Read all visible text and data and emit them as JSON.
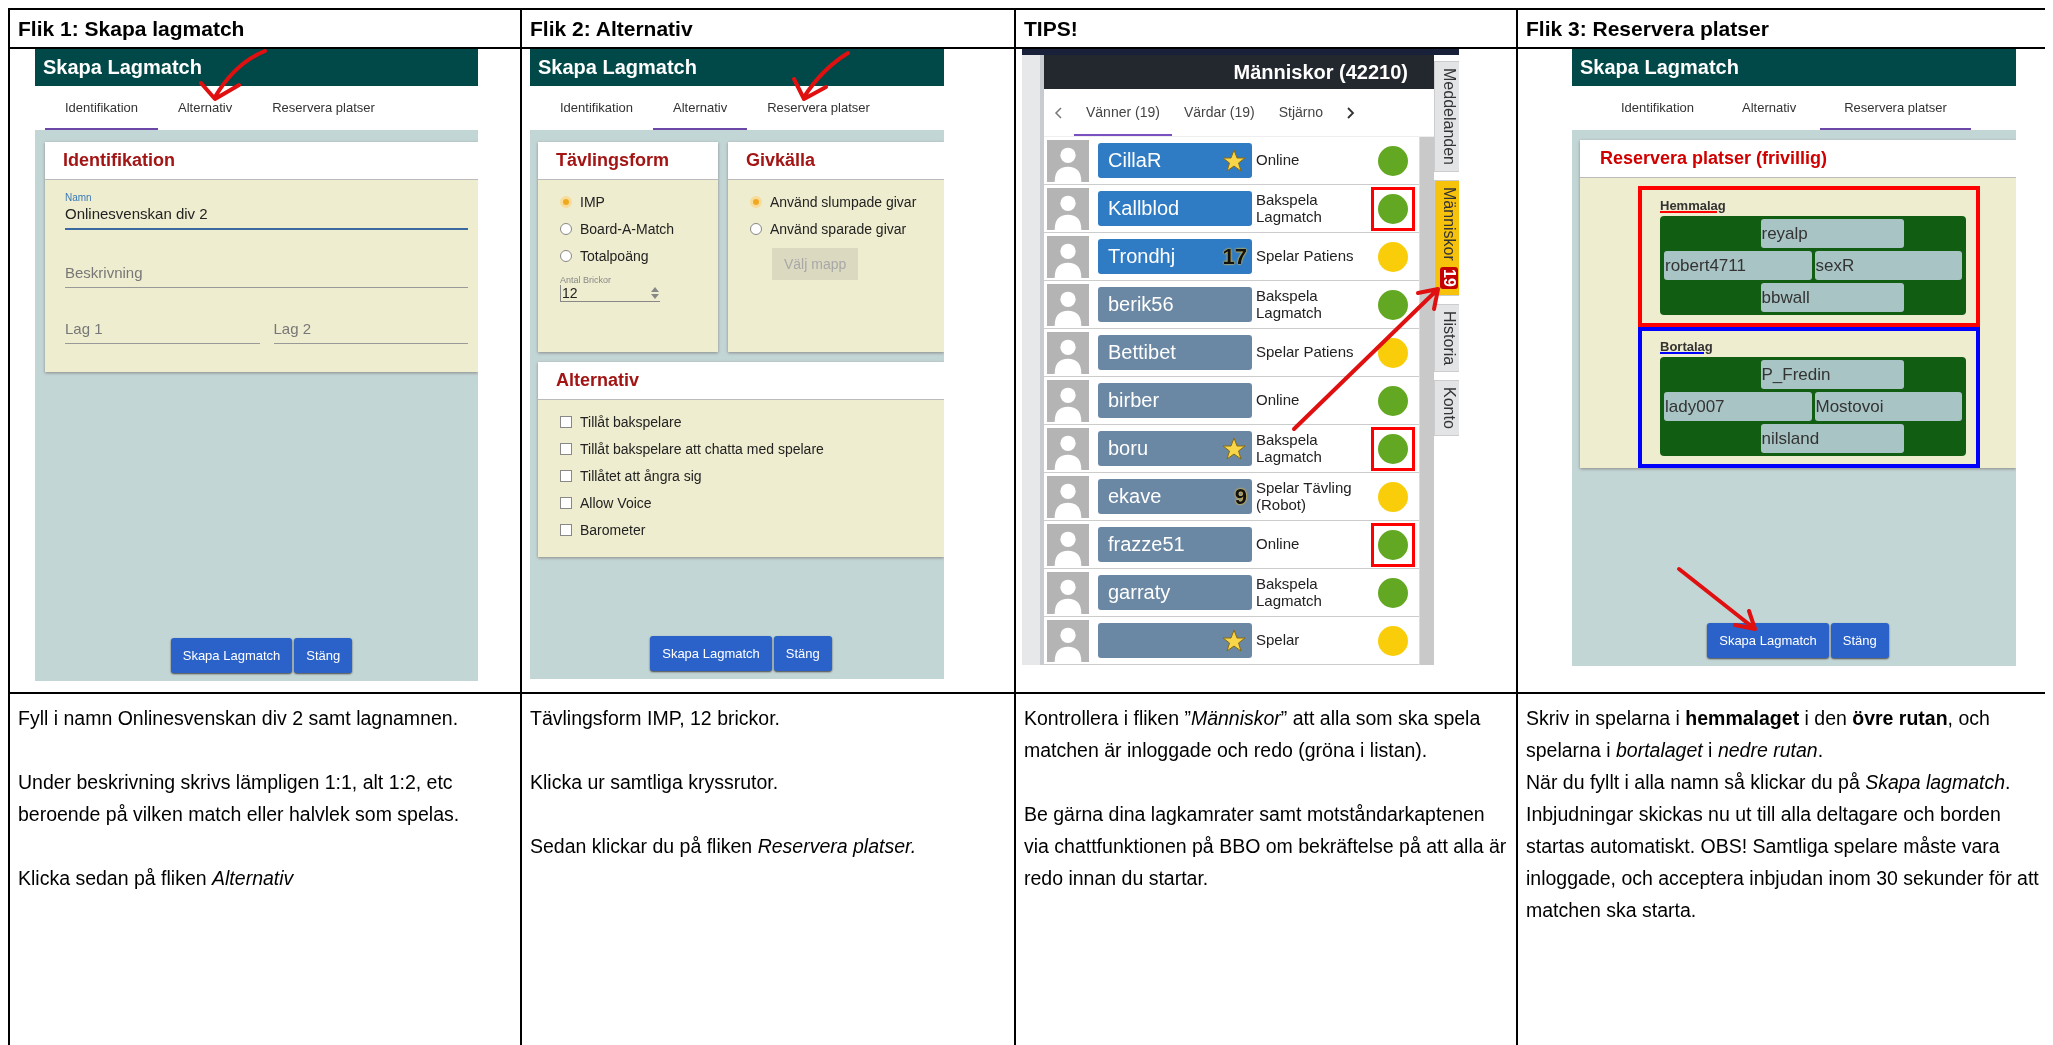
{
  "columns": [
    {
      "kind": "identification",
      "heading": "Flik 1: Skapa lagmatch",
      "screen": {
        "title": "Skapa Lagmatch",
        "tabs": [
          {
            "label": "Identifikation",
            "selected": true
          },
          {
            "label": "Alternativ",
            "selected": false
          },
          {
            "label": "Reservera platser",
            "selected": false
          }
        ],
        "section": "Identifikation",
        "name_field": {
          "label": "Namn",
          "value": "Onlinesvenskan div 2"
        },
        "description_field": {
          "placeholder": "Beskrivning"
        },
        "team_fields": [
          {
            "placeholder": "Lag 1"
          },
          {
            "placeholder": "Lag 2"
          }
        ],
        "buttons": [
          "Skapa Lagmatch",
          "Stäng"
        ]
      },
      "instructions": {
        "paragraphs": [
          "Fyll i namn Onlinesvenskan div 2 samt lagnamnen.",
          "Under beskrivning skrivs lämpligen 1:1, alt 1:2, etc beroende på vilken match eller halvlek som spelas.",
          "Klicka sedan på fliken *Alternativ*"
        ]
      }
    },
    {
      "kind": "options",
      "heading": "Flik 2: Alternativ",
      "screen": {
        "title": "Skapa Lagmatch",
        "tabs": [
          {
            "label": "Identifikation",
            "selected": false
          },
          {
            "label": "Alternativ",
            "selected": true
          },
          {
            "label": "Reservera platser",
            "selected": false
          }
        ],
        "groups": [
          {
            "title": "Tävlingsform",
            "options": [
              {
                "label": "IMP",
                "selected": true
              },
              {
                "label": "Board-A-Match",
                "selected": false
              },
              {
                "label": "Totalpoäng",
                "selected": false
              }
            ],
            "number_field": {
              "label": "Antal Brickor",
              "value": "12"
            }
          },
          {
            "title": "Givkälla",
            "options": [
              {
                "label": "Använd slumpade givar",
                "selected": true
              },
              {
                "label": "Använd sparade givar",
                "selected": false
              }
            ],
            "button": {
              "label": "Välj mapp",
              "disabled": true
            }
          }
        ],
        "options_section": {
          "title": "Alternativ",
          "checkboxes": [
            {
              "label": "Tillåt bakspelare",
              "checked": false
            },
            {
              "label": "Tillåt bakspelare att chatta med spelare",
              "checked": false
            },
            {
              "label": "Tillåtet att ångra sig",
              "checked": false
            },
            {
              "label": "Allow Voice",
              "checked": false
            },
            {
              "label": "Barometer",
              "checked": false
            }
          ]
        },
        "buttons": [
          "Skapa Lagmatch",
          "Stäng"
        ]
      },
      "instructions": {
        "paragraphs": [
          "Tävlingsform IMP, 12 brickor.",
          "Klicka ur samtliga kryssrutor.",
          "Sedan klickar du på fliken *Reservera platser.*"
        ]
      }
    },
    {
      "kind": "people",
      "heading": "TIPS!",
      "screen": {
        "header": "Människor (42210)",
        "tabs": [
          {
            "label": "Vänner (19)",
            "selected": true
          },
          {
            "label": "Värdar (19)",
            "selected": false
          },
          {
            "label": "Stjärno",
            "selected": false
          }
        ],
        "rows": [
          {
            "name": "CillaR",
            "highlighted": true,
            "badge": {
              "kind": "star"
            },
            "status": "Online",
            "color": "#63a822",
            "marked": false
          },
          {
            "name": "Kallblod",
            "highlighted": true,
            "status": "Bakspela Lagmatch",
            "color": "#63a822",
            "marked": true
          },
          {
            "name": "Trondhj",
            "highlighted": true,
            "badge": {
              "kind": "number",
              "text": "17"
            },
            "status": "Spelar Patiens",
            "color": "#f9cd0a",
            "marked": false
          },
          {
            "name": "berik56",
            "highlighted": false,
            "status": "Bakspela Lagmatch",
            "color": "#63a822",
            "marked": false
          },
          {
            "name": "Bettibet",
            "highlighted": false,
            "status": "Spelar Patiens",
            "color": "#f9cd0a",
            "marked": false
          },
          {
            "name": "birber",
            "highlighted": false,
            "status": "Online",
            "color": "#63a822",
            "marked": false
          },
          {
            "name": "boru",
            "highlighted": false,
            "badge": {
              "kind": "star"
            },
            "status": "Bakspela Lagmatch",
            "color": "#63a822",
            "marked": true
          },
          {
            "name": "ekave",
            "highlighted": false,
            "badge": {
              "kind": "number",
              "text": "9"
            },
            "status": "Spelar Tävling (Robot)",
            "color": "#f9cd0a",
            "marked": false
          },
          {
            "name": "frazze51",
            "highlighted": false,
            "status": "Online",
            "color": "#63a822",
            "marked": true
          },
          {
            "name": "garraty",
            "highlighted": false,
            "status": "Bakspela Lagmatch",
            "color": "#63a822",
            "marked": false
          },
          {
            "highlighted": false,
            "badge": {
              "kind": "star"
            },
            "status": "Spelar",
            "color": "#f9cd0a",
            "marked": false
          }
        ],
        "side_tabs": [
          {
            "label": "Meddelanden",
            "selected": false
          },
          {
            "label": "Människor",
            "selected": true,
            "count": "19"
          },
          {
            "label": "Historia",
            "selected": false
          },
          {
            "label": "Konto",
            "selected": false
          }
        ]
      },
      "instructions": {
        "paragraphs": [
          "Kontrollera i fliken ”*Människor*” att alla som ska spela matchen är inloggade och redo (gröna i listan).",
          "Be gärna dina lagkamrater samt motståndarkaptenen via chattfunktionen på BBO om bekräftelse på att alla är redo innan du startar."
        ]
      }
    },
    {
      "kind": "reserve",
      "heading": "Flik 3: Reservera platser",
      "screen": {
        "title": "Skapa Lagmatch",
        "tabs": [
          {
            "label": "Identifikation",
            "selected": false
          },
          {
            "label": "Alternativ",
            "selected": false
          },
          {
            "label": "Reservera platser",
            "selected": true
          }
        ],
        "section": "Reservera platser (frivillig)",
        "teams": [
          {
            "label": "Hemmalag",
            "color": "#ff0000",
            "seats": [
              "reyalp",
              "robert4711",
              "sexR",
              "bbwall"
            ]
          },
          {
            "label": "Bortalag",
            "color": "#0000ff",
            "seats": [
              "P_Fredin",
              "lady007",
              "Mostovoi",
              "nilsland"
            ]
          }
        ],
        "buttons": [
          "Skapa Lagmatch",
          "Stäng"
        ]
      },
      "instructions": {
        "paragraphs": [
          "Skriv in spelarna i **hemmalaget** i den **övre rutan**, och spelarna i *bortalaget* i *nedre rutan*.",
          "När du fyllt i alla namn så klickar du på *Skapa lagmatch*. Inbjudningar skickas nu ut till alla deltagare och borden startas automatiskt. OBS! Samtliga spelare måste vara inloggade, och acceptera inbjudan inom 30 sekunder för att matchen ska starta."
        ]
      }
    }
  ]
}
